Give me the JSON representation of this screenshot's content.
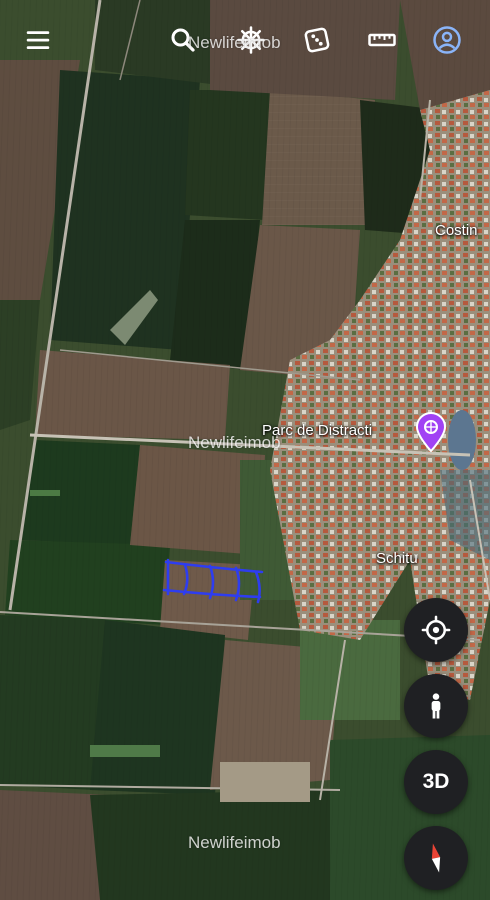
{
  "app": {
    "accent_color": "#8ab4f8",
    "fab_color": "#1f2023"
  },
  "watermarks": [
    "Newlifeimob",
    "Newlifeimob",
    "Newlifeimob"
  ],
  "places": {
    "town_label": "Costin",
    "park_label": "Parc de Distracti",
    "village_label": "Schitu"
  },
  "toolbar": {
    "menu_icon": "hamburger-menu-icon",
    "search_icon": "search-icon",
    "voyager_icon": "ship-wheel-icon",
    "random_icon": "dice-icon",
    "measure_icon": "ruler-icon",
    "account_icon": "account-circle-icon"
  },
  "controls": {
    "locate_icon": "my-location-icon",
    "pegman_icon": "street-view-person-icon",
    "view_3d_label": "3D",
    "compass_icon": "compass-icon"
  }
}
